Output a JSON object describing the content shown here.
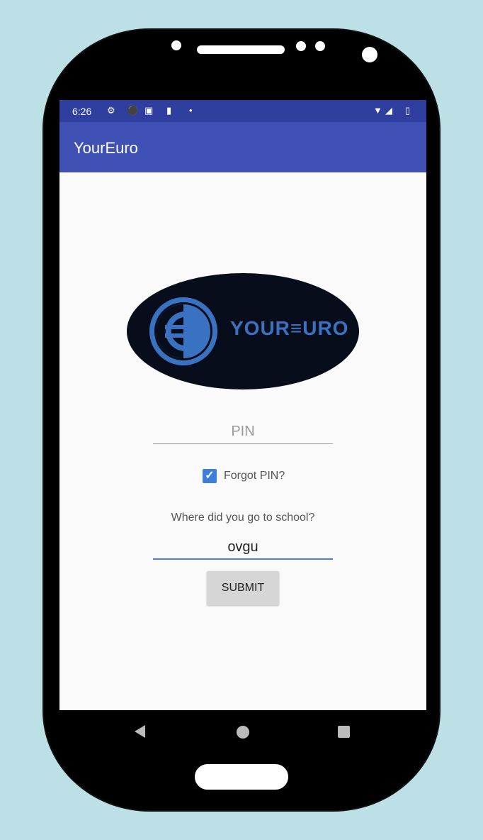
{
  "status_bar": {
    "time": "6:26",
    "left_icons": [
      "gear-icon",
      "shield-icon",
      "image-icon",
      "sd-card-icon",
      "dot-icon"
    ],
    "right_icons": [
      "wifi-icon",
      "signal-icon",
      "battery-icon"
    ]
  },
  "app_bar": {
    "title": "YourEuro"
  },
  "logo": {
    "text": "YOUR≡URO",
    "symbol": "€",
    "colors": {
      "background": "#080d1b",
      "accent": "#3a72c2"
    }
  },
  "pin_field": {
    "placeholder": "PIN",
    "value": ""
  },
  "forgot_pin": {
    "label": "Forgot PIN?",
    "checked": true
  },
  "security_question": {
    "label": "Where did you go to school?",
    "answer": "ovgu"
  },
  "submit_button": {
    "label": "SUBMIT"
  },
  "colors": {
    "status_bar": "#2f3f9f",
    "app_bar": "#4051b5",
    "accent": "#3f7fdc",
    "page_background": "#bde0e6"
  }
}
